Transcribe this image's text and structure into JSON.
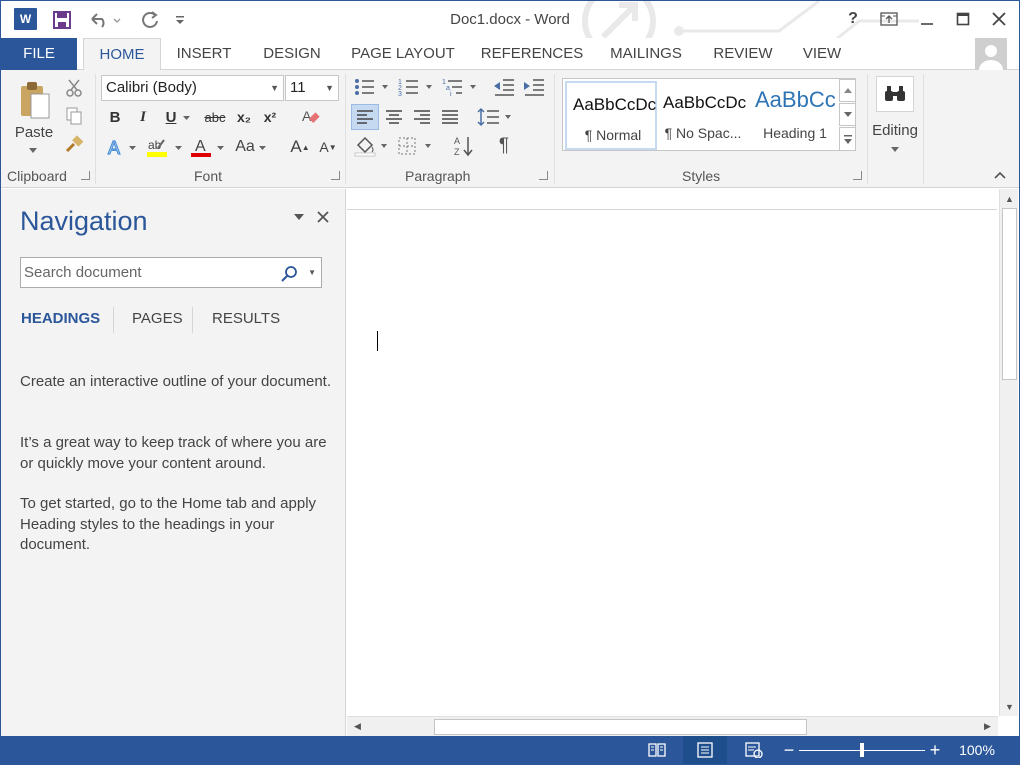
{
  "window": {
    "title": "Doc1.docx - Word",
    "help_icon": "?",
    "colors": {
      "brand": "#2b579a",
      "ribbon_bg": "#f3f3f3"
    }
  },
  "tabs": [
    "FILE",
    "HOME",
    "INSERT",
    "DESIGN",
    "PAGE LAYOUT",
    "REFERENCES",
    "MAILINGS",
    "REVIEW",
    "VIEW"
  ],
  "ribbon": {
    "clipboard": {
      "paste_label": "Paste",
      "group_label": "Clipboard"
    },
    "font": {
      "name": "Calibri (Body)",
      "size": "11",
      "bold": "B",
      "italic": "I",
      "underline": "U",
      "strikethrough": "abc",
      "subscript": "x₂",
      "superscript": "x²",
      "change_case": "Aa",
      "grow": "A",
      "shrink": "A",
      "group_label": "Font"
    },
    "paragraph": {
      "show_marks": "¶",
      "group_label": "Paragraph"
    },
    "styles": {
      "items": [
        {
          "sample": "AaBbCcDc",
          "name": "¶ Normal"
        },
        {
          "sample": "AaBbCcDc",
          "name": "¶ No Spac..."
        },
        {
          "sample": "AaBbCc",
          "name": "Heading 1"
        }
      ],
      "group_label": "Styles"
    },
    "editing": {
      "label": "Editing"
    }
  },
  "navigation": {
    "title": "Navigation",
    "search_placeholder": "Search document",
    "tabs": [
      "HEADINGS",
      "PAGES",
      "RESULTS"
    ],
    "paragraphs": [
      "Create an interactive outline of your document.",
      "It’s a great way to keep track of where you are or quickly move your content around.",
      "To get started, go to the Home tab and apply Heading styles to the headings in your document."
    ]
  },
  "status_bar": {
    "zoom_level": "100%",
    "zoom_fraction": 0.5
  }
}
